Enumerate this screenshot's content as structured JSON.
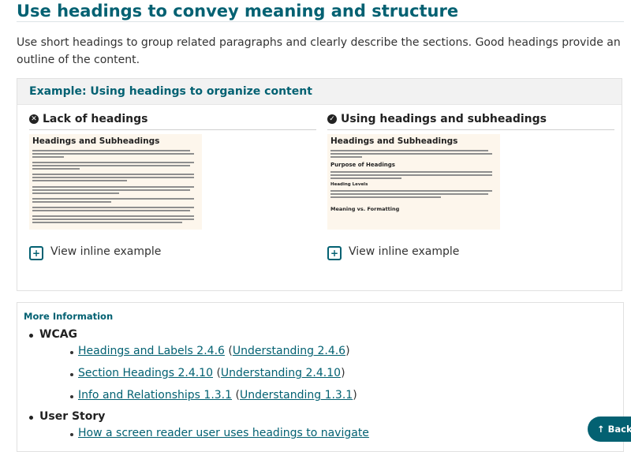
{
  "heading": "Use headings to convey meaning and structure",
  "intro": "Use short headings to group related paragraphs and clearly describe the sections. Good headings provide an outline of the content.",
  "example": {
    "title": "Example: Using headings to organize content",
    "bad": {
      "heading": "Lack of headings",
      "icon": "circle-x-icon",
      "thumb_title": "Headings and Subheadings",
      "link": "View inline example"
    },
    "good": {
      "heading": "Using headings and subheadings",
      "icon": "circle-check-icon",
      "thumb_title": "Headings and Subheadings",
      "thumb_sub1": "Purpose of Headings",
      "thumb_sub2": "Heading Levels",
      "thumb_sub3": "Meaning vs. Formatting",
      "link": "View inline example"
    }
  },
  "more_info": {
    "title": "More Information",
    "groups": [
      {
        "label": "WCAG",
        "items": [
          {
            "link": "Headings and Labels 2.4.6",
            "paren_link": "Understanding 2.4.6"
          },
          {
            "link": "Section Headings 2.4.10",
            "paren_link": "Understanding 2.4.10"
          },
          {
            "link": "Info and Relationships 1.3.1",
            "paren_link": "Understanding 1.3.1"
          }
        ]
      },
      {
        "label": "User Story",
        "items": [
          {
            "link": "How a screen reader user uses headings to navigate"
          }
        ]
      }
    ]
  },
  "back_to_top": "↑ Back",
  "colors": {
    "accent": "#036172",
    "panel_header": "#f2f2f2",
    "thumb_bg": "#fdf6ec"
  }
}
